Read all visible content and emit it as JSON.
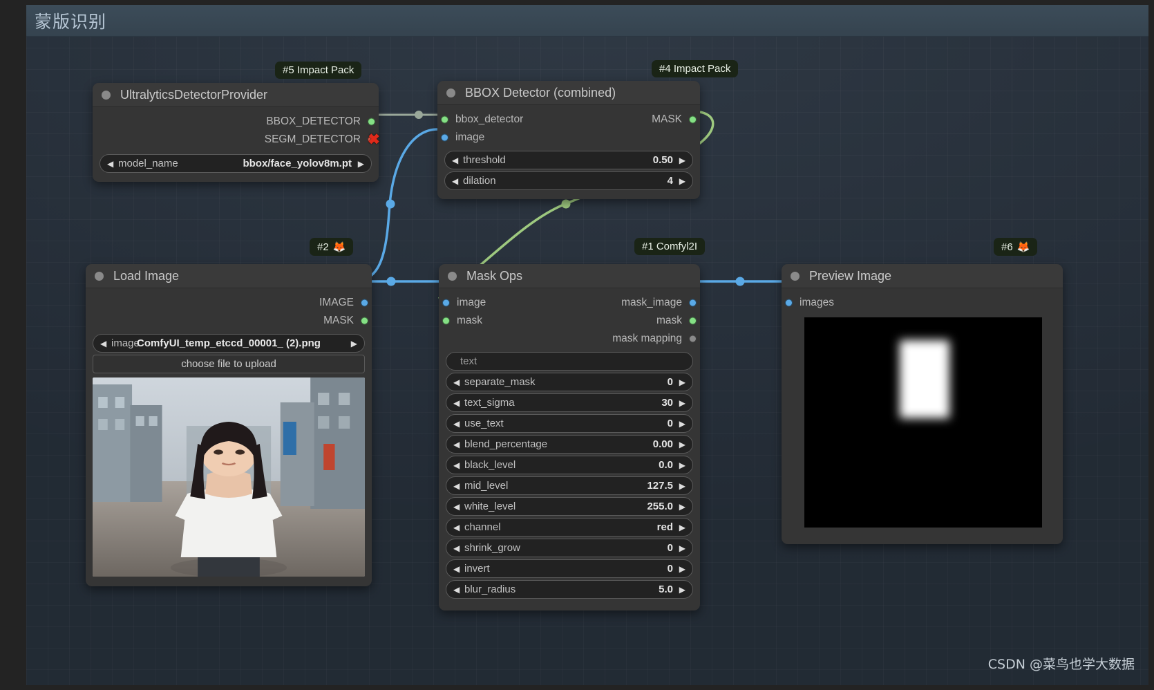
{
  "window": {
    "title": "蒙版识别"
  },
  "watermark": "CSDN @菜鸟也学大数据",
  "badges": {
    "n5": "#5 Impact Pack",
    "n4": "#4 Impact Pack",
    "n2": "#2",
    "n2_icon": "fox-icon",
    "n1": "#1 Comfyl2I",
    "n6": "#6",
    "n6_icon": "fox-icon"
  },
  "nodes": {
    "ultralytics": {
      "title": "UltralyticsDetectorProvider",
      "outputs": [
        {
          "label": "BBOX_DETECTOR",
          "color": "#85e085"
        },
        {
          "label": "SEGM_DETECTOR",
          "color": "#e85c4a"
        }
      ],
      "widgets": [
        {
          "label": "model_name",
          "value": "bbox/face_yolov8m.pt"
        }
      ]
    },
    "bbox_detector": {
      "title": "BBOX Detector (combined)",
      "inputs": [
        {
          "label": "bbox_detector",
          "color": "#85e085"
        },
        {
          "label": "image",
          "color": "#5aa9e6"
        }
      ],
      "outputs": [
        {
          "label": "MASK",
          "color": "#85e085"
        }
      ],
      "widgets": [
        {
          "label": "threshold",
          "value": "0.50"
        },
        {
          "label": "dilation",
          "value": "4"
        }
      ]
    },
    "load_image": {
      "title": "Load Image",
      "outputs": [
        {
          "label": "IMAGE",
          "color": "#5aa9e6"
        },
        {
          "label": "MASK",
          "color": "#85e085"
        }
      ],
      "widgets": [
        {
          "label": "image",
          "value": "ComfyUI_temp_etccd_00001_ (2).png"
        }
      ],
      "button": "choose file to upload"
    },
    "mask_ops": {
      "title": "Mask Ops",
      "inputs": [
        {
          "label": "image",
          "color": "#5aa9e6"
        },
        {
          "label": "mask",
          "color": "#85e085"
        }
      ],
      "outputs": [
        {
          "label": "mask_image",
          "color": "#5aa9e6"
        },
        {
          "label": "mask",
          "color": "#85e085"
        },
        {
          "label": "mask mapping",
          "color": "#8a8a8a"
        }
      ],
      "text_widget_placeholder": "text",
      "widgets": [
        {
          "label": "separate_mask",
          "value": "0"
        },
        {
          "label": "text_sigma",
          "value": "30"
        },
        {
          "label": "use_text",
          "value": "0"
        },
        {
          "label": "blend_percentage",
          "value": "0.00"
        },
        {
          "label": "black_level",
          "value": "0.0"
        },
        {
          "label": "mid_level",
          "value": "127.5"
        },
        {
          "label": "white_level",
          "value": "255.0"
        },
        {
          "label": "channel",
          "value": "red"
        },
        {
          "label": "shrink_grow",
          "value": "0"
        },
        {
          "label": "invert",
          "value": "0"
        },
        {
          "label": "blur_radius",
          "value": "5.0"
        }
      ]
    },
    "preview_image": {
      "title": "Preview Image",
      "inputs": [
        {
          "label": "images",
          "color": "#5aa9e6"
        }
      ]
    }
  },
  "colors": {
    "canvas_bg": "#2a3440",
    "node_bg": "#353535",
    "link_blue": "#5aa9e6",
    "link_green": "#9ec97f",
    "link_gray": "#9aa89a",
    "badge_bg": "#1a2416"
  }
}
